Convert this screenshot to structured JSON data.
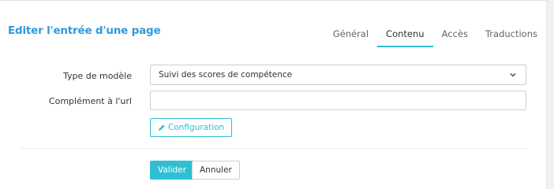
{
  "header": {
    "title": "Editer l'entrée d'une page"
  },
  "tabs": [
    {
      "label": "Général",
      "active": false
    },
    {
      "label": "Contenu",
      "active": true
    },
    {
      "label": "Accès",
      "active": false
    },
    {
      "label": "Traductions",
      "active": false
    }
  ],
  "form": {
    "template_type": {
      "label": "Type de modèle",
      "selected": "Suivi des scores de compétence"
    },
    "url_complement": {
      "label": "Complément à l'url",
      "value": "",
      "placeholder": ""
    },
    "configuration_button": "Configuration"
  },
  "actions": {
    "submit_label": "Valider",
    "cancel_label": "Annuler"
  },
  "colors": {
    "title": "#3498db",
    "accent": "#2fbfd3"
  },
  "icons": {
    "pencil": "pencil-icon",
    "dropdown": "chevron-down-icon"
  }
}
